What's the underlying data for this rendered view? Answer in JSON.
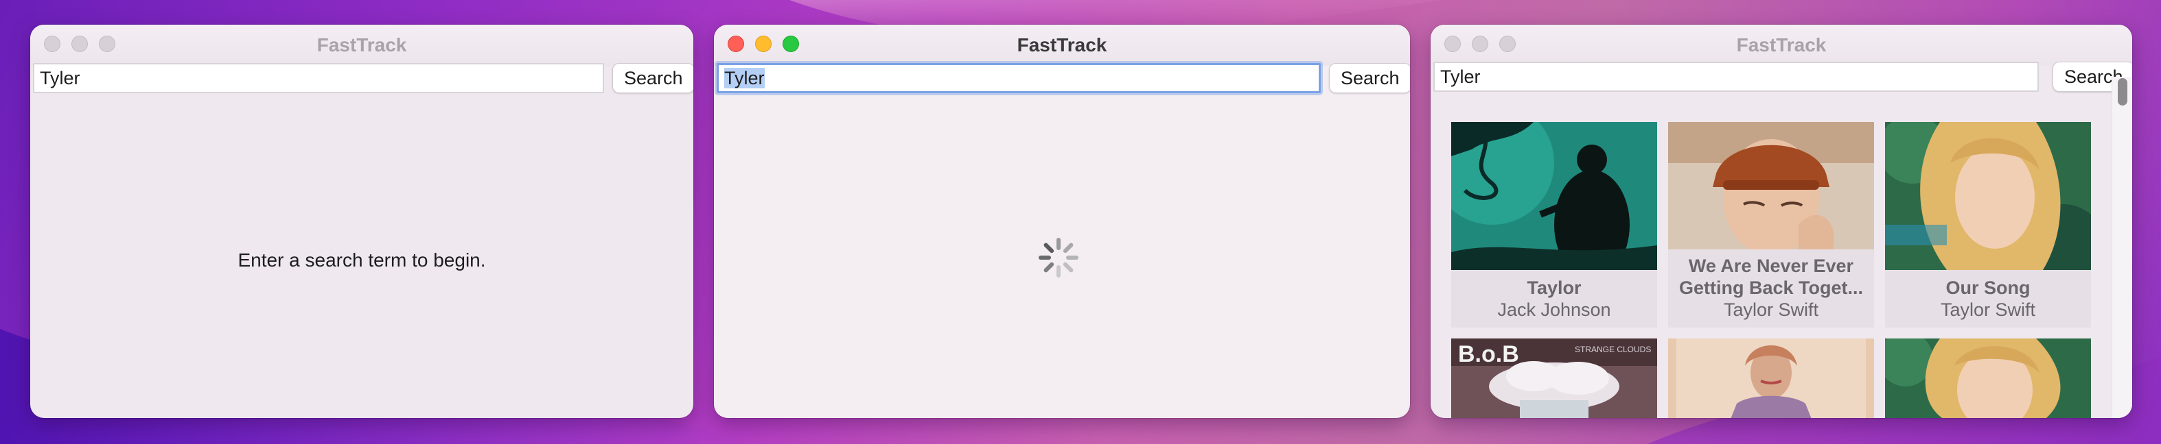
{
  "windows": [
    {
      "title": "FastTrack",
      "active": false,
      "search": {
        "value": "Tyler",
        "button_label": "Search"
      },
      "status_message": "Enter a search term to begin."
    },
    {
      "title": "FastTrack",
      "active": true,
      "search": {
        "value": "Tyler",
        "button_label": "Search"
      },
      "loading": true
    },
    {
      "title": "FastTrack",
      "active": false,
      "search": {
        "value": "Tyler",
        "button_label": "Search"
      },
      "results": [
        {
          "title": "Taylor",
          "artist": "Jack Johnson"
        },
        {
          "title": "We Are Never Ever Getting Back Toget...",
          "artist": "Taylor Swift"
        },
        {
          "title": "Our Song",
          "artist": "Taylor Swift"
        },
        {
          "title": "",
          "artist": "",
          "art_text": "B.o.B",
          "art_subtext": "STRANGE CLOUDS"
        },
        {
          "title": "",
          "artist": ""
        },
        {
          "title": "",
          "artist": ""
        }
      ]
    }
  ]
}
